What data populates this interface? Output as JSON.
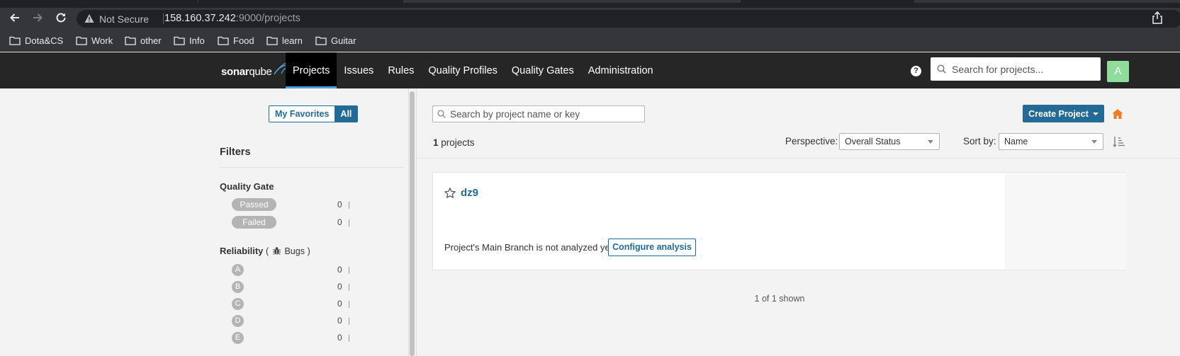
{
  "browser": {
    "not_secure": "Not Secure",
    "url_host": "158.160.37.242",
    "url_rest": ":9000/projects",
    "bookmarks": [
      "Dota&CS",
      "Work",
      "other",
      "Info",
      "Food",
      "learn",
      "Guitar"
    ]
  },
  "nav": {
    "logo_bold": "sonar",
    "logo_light": "qube",
    "items": [
      "Projects",
      "Issues",
      "Rules",
      "Quality Profiles",
      "Quality Gates",
      "Administration"
    ],
    "help": "?",
    "search_placeholder": "Search for projects...",
    "avatar": "A"
  },
  "sidebar": {
    "toggle_favorites": "My Favorites",
    "toggle_all": "All",
    "filters_title": "Filters",
    "quality_gate": {
      "title": "Quality Gate",
      "options": [
        {
          "label": "Passed",
          "count": "0"
        },
        {
          "label": "Failed",
          "count": "0"
        }
      ]
    },
    "reliability": {
      "title": "Reliability",
      "open_paren": "(",
      "bugs_label": "Bugs",
      "close_paren": ")",
      "ratings": [
        {
          "label": "A",
          "count": "0"
        },
        {
          "label": "B",
          "count": "0"
        },
        {
          "label": "C",
          "count": "0"
        },
        {
          "label": "D",
          "count": "0"
        },
        {
          "label": "E",
          "count": "0"
        }
      ]
    }
  },
  "main": {
    "search_placeholder": "Search by project name or key",
    "create_project": "Create Project",
    "project_count": "1",
    "projects_word": "projects",
    "perspective_label": "Perspective:",
    "perspective_value": "Overall Status",
    "sort_label": "Sort by:",
    "sort_value": "Name",
    "project": {
      "name": "dz9",
      "status_text": "Project's Main Branch is not analyzed yet.",
      "configure_button": "Configure analysis"
    },
    "shown_text": "1 of 1 shown"
  },
  "colors": {
    "accent": "#236a97",
    "nav_bg": "#262626",
    "home_icon": "#ed7d20",
    "avatar_bg": "#8fdc9c"
  }
}
